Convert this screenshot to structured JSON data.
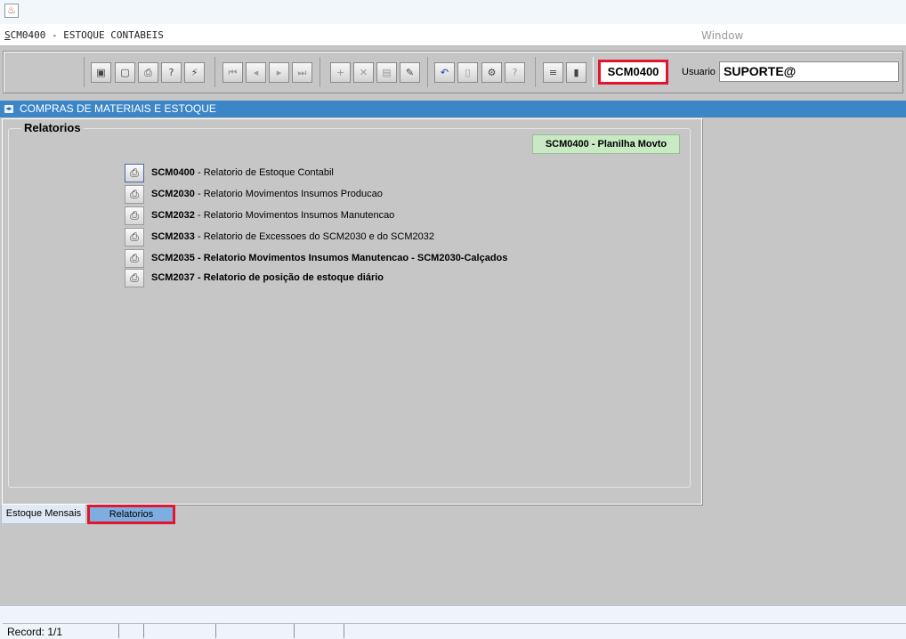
{
  "window": {
    "title_first_letter": "S",
    "title_rest": "CM0400 - ESTOQUE CONTABEIS",
    "menu_window": "Window",
    "app_icon": "java-coffee-icon"
  },
  "toolbar": {
    "buttons": [
      {
        "name": "save-button",
        "icon": "floppy-icon",
        "glyph": "▣"
      },
      {
        "name": "window-button",
        "icon": "monitor-icon",
        "glyph": "▢"
      },
      {
        "name": "print-button",
        "icon": "printer-icon",
        "glyph": "⎙"
      },
      {
        "name": "query-button",
        "icon": "query-icon",
        "glyph": "?"
      },
      {
        "name": "execute-query-button",
        "icon": "lightning-icon",
        "glyph": "⚡"
      },
      {
        "name": "first-record-button",
        "icon": "first-record-icon",
        "glyph": "⏮"
      },
      {
        "name": "prev-record-button",
        "icon": "prev-record-icon",
        "glyph": "◂"
      },
      {
        "name": "next-record-button",
        "icon": "next-record-icon",
        "glyph": "▸"
      },
      {
        "name": "last-record-button",
        "icon": "last-record-icon",
        "glyph": "⏭"
      },
      {
        "name": "insert-record-button",
        "icon": "plus-icon",
        "glyph": "+"
      },
      {
        "name": "delete-record-button",
        "icon": "delete-x-icon",
        "glyph": "✕"
      },
      {
        "name": "duplicate-record-button",
        "icon": "document-edit-icon",
        "glyph": "▤"
      },
      {
        "name": "clear-record-button",
        "icon": "eraser-icon",
        "glyph": "✎"
      },
      {
        "name": "undo-button",
        "icon": "undo-icon",
        "glyph": "↶"
      },
      {
        "name": "list-button",
        "icon": "clipboard-icon",
        "glyph": "▯"
      },
      {
        "name": "edit-button",
        "icon": "gear-edit-icon",
        "glyph": "⚙"
      },
      {
        "name": "help-button",
        "icon": "question-icon",
        "glyph": "?"
      },
      {
        "name": "menu-button",
        "icon": "menu-icon",
        "glyph": "≡"
      },
      {
        "name": "exit-button",
        "icon": "exit-door-icon",
        "glyph": "▮"
      }
    ],
    "form_code": "SCM0400",
    "usuario_label": "Usuario",
    "usuario_value": "SUPORTE@"
  },
  "module": {
    "title": "COMPRAS DE MATERIAIS E ESTOQUE",
    "icon": "module-arrows-icon"
  },
  "reports_panel": {
    "group_title": "Relatorios",
    "planilha_button": "SCM0400 - Planilha Movto",
    "items": [
      {
        "code": "SCM0400",
        "desc": " - Relatorio de Estoque Contabil",
        "bold": false
      },
      {
        "code": "SCM2030",
        "desc": " - Relatorio Movimentos Insumos Producao",
        "bold": false
      },
      {
        "code": "SCM2032",
        "desc": " - Relatorio Movimentos Insumos Manutencao",
        "bold": false
      },
      {
        "code": "SCM2033",
        "desc": " - Relatorio de Excessoes do SCM2030 e do SCM2032",
        "bold": false
      },
      {
        "code": "SCM2035",
        "desc": " - Relatorio Movimentos Insumos Manutencao - SCM2030-Calçados",
        "bold": true
      },
      {
        "code": "SCM2037",
        "desc": " - Relatorio de posição de estoque diário",
        "bold": true
      }
    ],
    "item_icon": "printer-icon"
  },
  "tabs": [
    {
      "label": "Estoque Mensais",
      "active": false
    },
    {
      "label": "Relatorios",
      "active": true
    }
  ],
  "status": {
    "record": "Record: 1/1"
  }
}
